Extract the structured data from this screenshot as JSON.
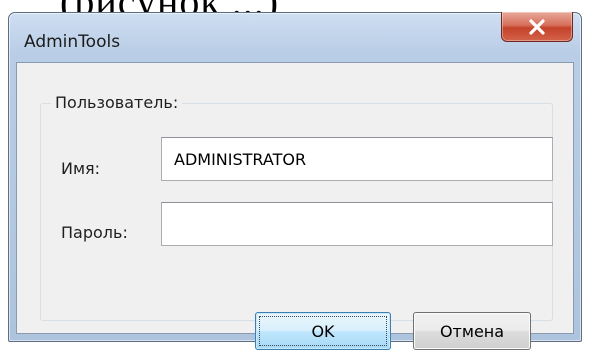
{
  "background_text": "(рисунок ...)",
  "window": {
    "title": "AdminTools",
    "close_symbol": "X",
    "accent_close": "#c4422a",
    "frame_color": "#b9cde6"
  },
  "group": {
    "legend": "Пользователь:"
  },
  "fields": {
    "name_label": "Имя:",
    "name_value": "ADMINISTRATOR",
    "password_label": "Пароль:",
    "password_value": ""
  },
  "buttons": {
    "ok_label": "OK",
    "cancel_label": "Отмена"
  },
  "icons": {
    "close": "close-icon"
  }
}
